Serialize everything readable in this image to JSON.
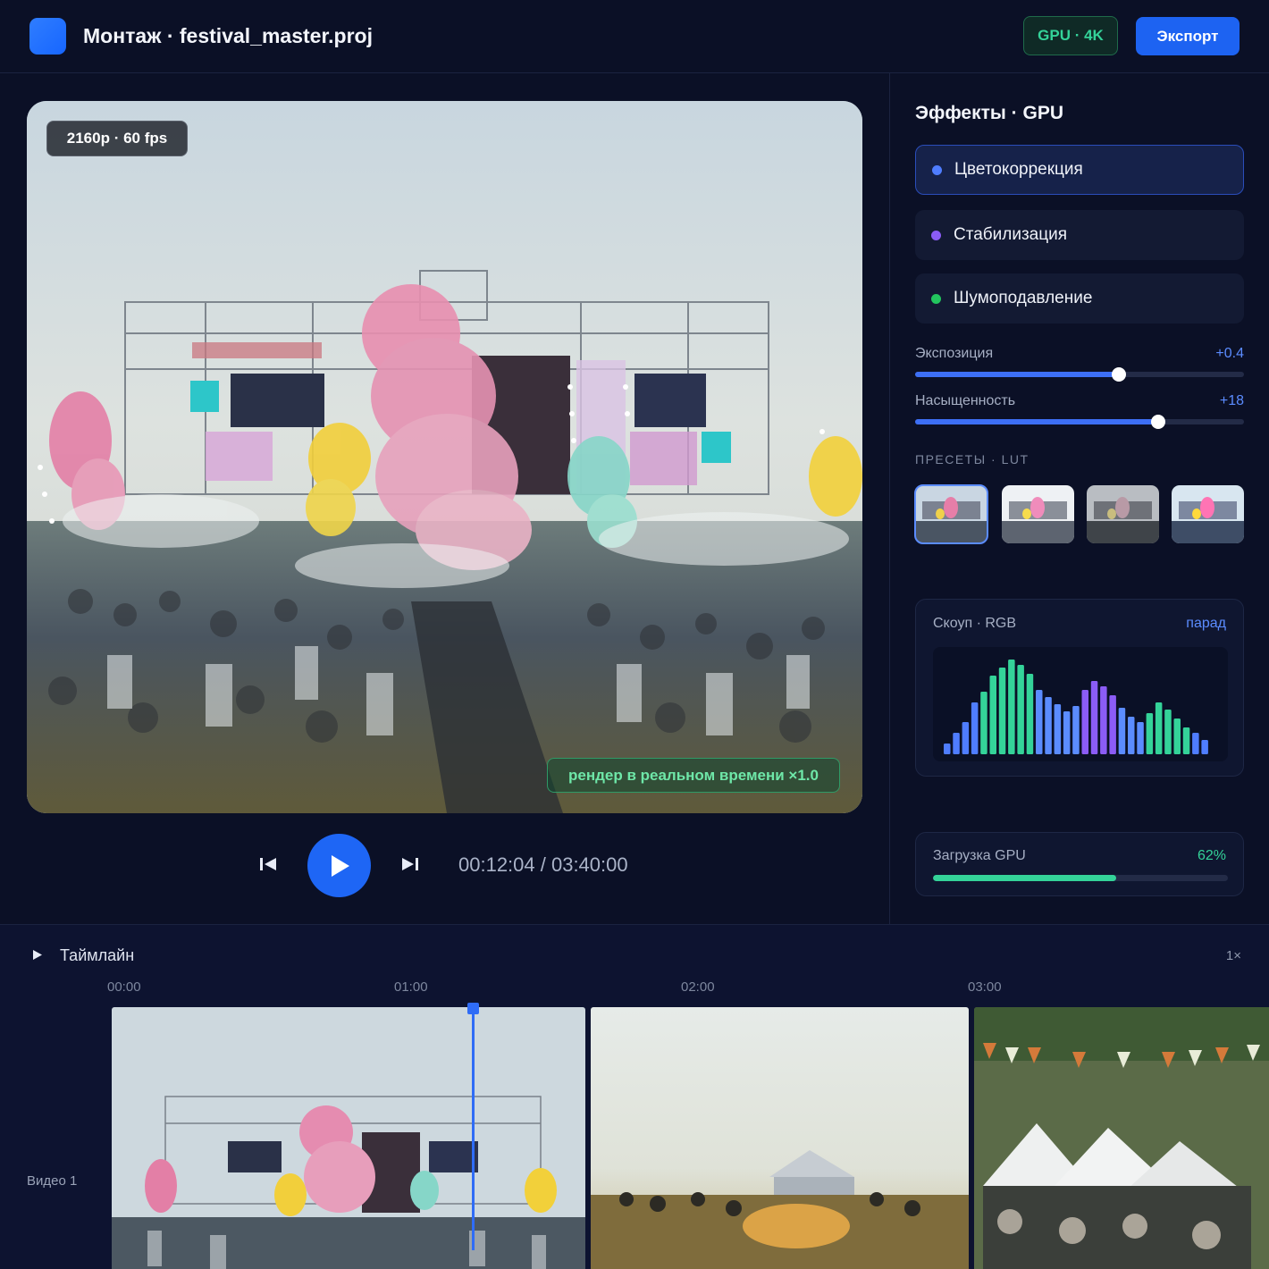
{
  "header": {
    "title": "Монтаж · festival_master.proj",
    "gpu_badge": "GPU · 4K",
    "export_label": "Экспорт"
  },
  "preview": {
    "resolution_badge": "2160p · 60 fps",
    "render_badge": "рендер в реальном времени ×1.0"
  },
  "transport": {
    "timecode": "00:12:04 / 03:40:00"
  },
  "effects": {
    "title": "Эффекты · GPU",
    "items": [
      {
        "label": "Цветокоррекция",
        "color": "#4f7dff",
        "active": true
      },
      {
        "label": "Стабилизация",
        "color": "#8b5cf6",
        "active": false
      },
      {
        "label": "Шумоподавление",
        "color": "#22c55e",
        "active": false
      }
    ],
    "sliders": [
      {
        "label": "Экспозиция",
        "value": "+0.4",
        "fraction": 0.62
      },
      {
        "label": "Насыщенность",
        "value": "+18",
        "fraction": 0.74
      }
    ],
    "presets_label": "ПРЕСЕТЫ · LUT"
  },
  "scope": {
    "title": "Скоуп · RGB",
    "mode": "парад"
  },
  "gpu": {
    "label": "Загрузка GPU",
    "value": "62%",
    "fraction": 0.62
  },
  "timeline": {
    "title": "Таймлайн",
    "zoom": "1×",
    "ticks": [
      "00:00",
      "01:00",
      "02:00",
      "03:00"
    ],
    "track_label": "Видео 1"
  },
  "colors": {
    "accent": "#1e66f5",
    "green": "#34d399",
    "background": "#0b1026"
  }
}
